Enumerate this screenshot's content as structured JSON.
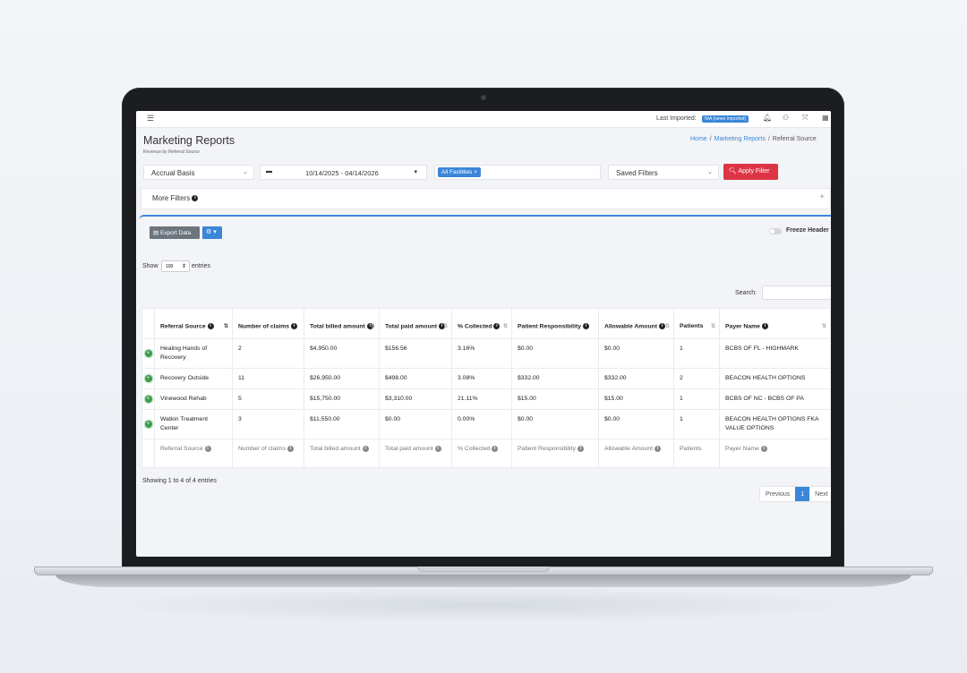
{
  "topbar": {
    "menu_icon": "hamburger-icon",
    "last_imported_label": "Last Imported:",
    "import_badge": "N/A (never imported)",
    "icons": [
      "bell-icon",
      "user-icon",
      "expand-icon",
      "grid-icon"
    ]
  },
  "header": {
    "title": "Marketing Reports",
    "subtitle": "Revenue by Referral Source",
    "breadcrumb": [
      "Home",
      "Marketing Reports",
      "Referral Source"
    ]
  },
  "filters": {
    "basis": "Accrual Basis",
    "date_range": "10/14/2025 - 04/14/2026",
    "facility_tag": "All Facilities",
    "saved_filters": "Saved Filters",
    "apply_label": "Apply Filter",
    "more_filters_label": "More Filters"
  },
  "toolbar": {
    "export_label": "Export Data",
    "freeze_label": "Freeze Header"
  },
  "table_controls": {
    "show_label": "Show",
    "page_size": "100",
    "entries_label": "entries",
    "search_label": "Search:"
  },
  "table": {
    "columns": [
      {
        "label": "Referral Source",
        "info": true
      },
      {
        "label": "Number of claims",
        "info": true
      },
      {
        "label": "Total billed amount",
        "info": true
      },
      {
        "label": "Total paid amount",
        "info": true
      },
      {
        "label": "% Collected",
        "info": true
      },
      {
        "label": "Patient Responsibility",
        "info": true
      },
      {
        "label": "Allowable Amount",
        "info": true
      },
      {
        "label": "Patients",
        "info": false
      },
      {
        "label": "Payer Name",
        "info": true
      }
    ],
    "rows": [
      [
        "Healing Hands of Recovery",
        "2",
        "$4,950.00",
        "$156.56",
        "3.16%",
        "$0.00",
        "$0.00",
        "1",
        "BCBS OF FL - HIGHMARK"
      ],
      [
        "Recovery Outside",
        "11",
        "$26,950.00",
        "$498.00",
        "3.08%",
        "$332.00",
        "$332.00",
        "2",
        "BEACON HEALTH OPTIONS"
      ],
      [
        "Vinewood Rehab",
        "5",
        "$15,750.00",
        "$3,310.00",
        "21.11%",
        "$15.00",
        "$15.00",
        "1",
        "BCBS OF NC - BCBS OF PA"
      ],
      [
        "Watkin Treatment Center",
        "3",
        "$11,550.00",
        "$0.00",
        "0.00%",
        "$0.00",
        "$0.00",
        "1",
        "BEACON HEALTH OPTIONS FKA VALUE OPTIONS"
      ]
    ]
  },
  "footer": {
    "showing_text": "Showing 1 to 4 of 4 entries",
    "prev_label": "Previous",
    "current_page": "1",
    "next_label": "Next"
  }
}
